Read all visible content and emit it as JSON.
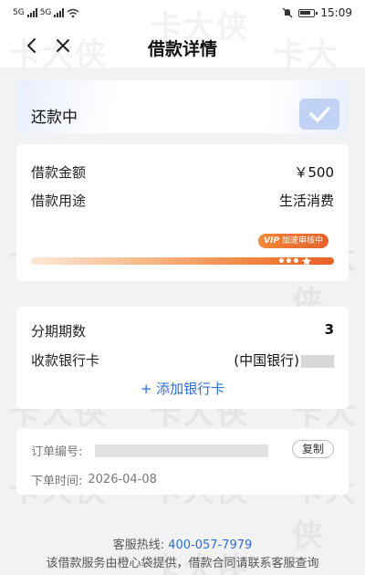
{
  "status_bar": {
    "signal_1": "5G",
    "signal_2": "5G",
    "time": "15:09",
    "icons": [
      "mute-icon",
      "battery-icon",
      "wifi-icon",
      "signal-icon"
    ]
  },
  "nav": {
    "title": "借款详情",
    "back_icon": "chevron-left-icon",
    "close_icon": "close-icon"
  },
  "status": {
    "label": "还款中",
    "icon": "check-badge-icon"
  },
  "loan": {
    "amount_label": "借款金额",
    "amount_value": "￥500",
    "purpose_label": "借款用途",
    "purpose_value": "生活消费",
    "vip_tag": "VIP",
    "vip_text": "加速审核中"
  },
  "installment": {
    "periods_label": "分期期数",
    "periods_value": "3",
    "bank_label": "收款银行卡",
    "bank_value": "(中国银行)",
    "add_card_label": "+ 添加银行卡"
  },
  "order": {
    "number_label": "订单编号:",
    "copy_label": "复制",
    "time_label": "下单时间:",
    "time_value": "2026-04-08"
  },
  "footer": {
    "hotline_label": "客服热线:",
    "hotline_number": "400-057-7979",
    "notice": "该借款服务由橙心袋提供，借款合同请联系客服查询"
  },
  "watermark": {
    "text": "卡大侠",
    "url": "www.kadaxia.com"
  },
  "colors": {
    "accent": "#2e6cd6",
    "progress_orange": "#e5602a",
    "background": "#f2f2f4"
  }
}
